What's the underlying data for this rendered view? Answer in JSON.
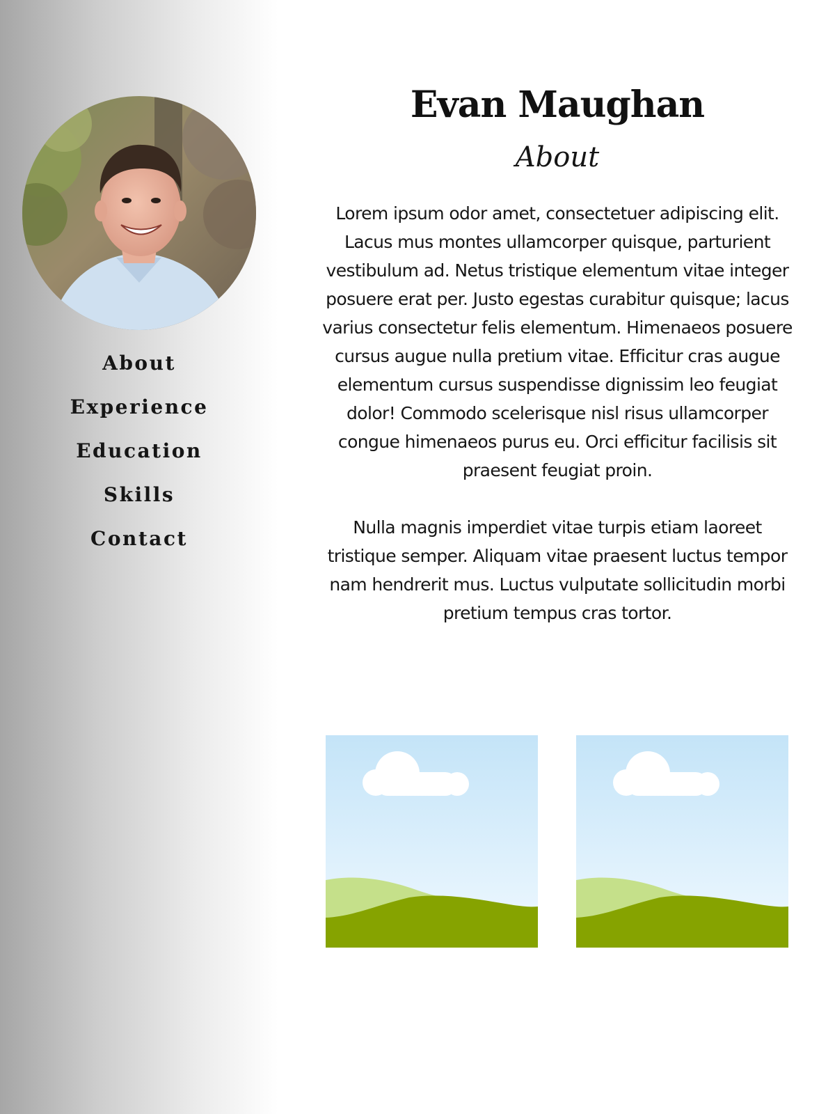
{
  "profile": {
    "name": "Evan Maughan",
    "section_heading": "About",
    "avatar_icon": "profile-photo"
  },
  "nav": {
    "items": [
      {
        "label": "About"
      },
      {
        "label": "Experience"
      },
      {
        "label": "Education"
      },
      {
        "label": "Skills"
      },
      {
        "label": "Contact"
      }
    ]
  },
  "about": {
    "paragraphs": [
      "Lorem ipsum odor amet, consectetuer adipiscing elit. Lacus mus montes ullamcorper quisque, parturient vestibulum ad. Netus tristique elementum vitae integer posuere erat per. Justo egestas curabitur quisque; lacus varius consectetur felis elementum. Himenaeos posuere cursus augue nulla pretium vitae. Efficitur cras augue elementum cursus suspendisse dignissim leo feugiat dolor! Commodo scelerisque nisl risus ullamcorper congue himenaeos purus eu. Orci efficitur facilisis sit praesent feugiat proin.",
      "Nulla magnis imperdiet vitae turpis etiam laoreet tristique semper. Aliquam vitae praesent luctus tempor nam hendrerit mus. Luctus vulputate sollicitudin morbi pretium tempus cras tortor."
    ]
  },
  "gallery": {
    "images": [
      {
        "icon": "landscape-placeholder-icon"
      },
      {
        "icon": "landscape-placeholder-icon"
      }
    ]
  },
  "colors": {
    "sidebar_gradient_start": "#a6a6a6",
    "sidebar_gradient_end": "#ffffff",
    "text": "#111111",
    "sky_top": "#c4e4f8",
    "sky_bottom": "#eef8fe",
    "hill_light": "#c5e08a",
    "hill_dark": "#86a300",
    "cloud": "#ffffff"
  }
}
